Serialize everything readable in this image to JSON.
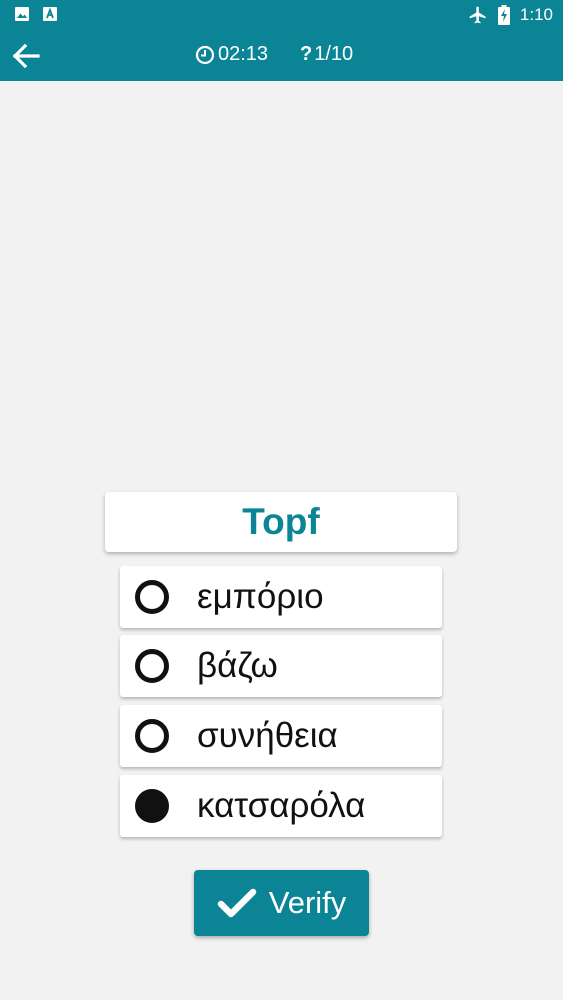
{
  "status_bar": {
    "time": "1:10",
    "icons": [
      "image-icon",
      "text-a-icon",
      "airplane-icon",
      "battery-charging-icon"
    ]
  },
  "app_bar": {
    "back_icon": "arrow-left-icon",
    "timer_icon": "clock-icon",
    "timer": "02:13",
    "counter_icon": "question-mark-icon",
    "counter_mark": "?",
    "counter": "1/10"
  },
  "quiz": {
    "word": "Topf",
    "options": [
      {
        "label": "εμπόριο",
        "selected": false
      },
      {
        "label": "βάζω",
        "selected": false
      },
      {
        "label": "συνήθεια",
        "selected": false
      },
      {
        "label": "κατσαρόλα",
        "selected": true
      }
    ],
    "verify_label": "Verify"
  },
  "colors": {
    "primary": "#0b8595",
    "background": "#f2f2f2",
    "card": "#ffffff",
    "radio": "#111111"
  }
}
